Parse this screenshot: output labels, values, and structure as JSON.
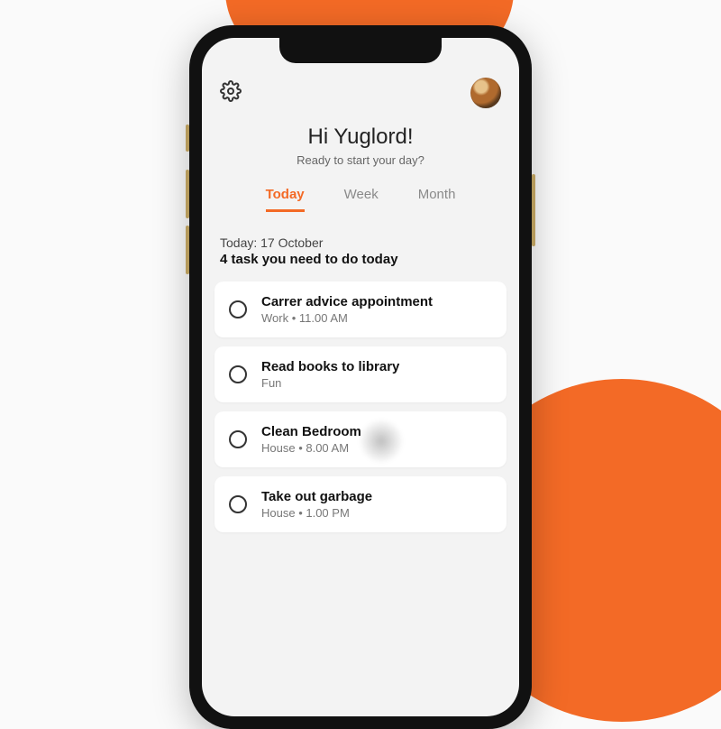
{
  "colors": {
    "accent": "#f36a26"
  },
  "greeting": {
    "title": "Hi Yuglord!",
    "subtitle": "Ready to start your day?"
  },
  "tabs": {
    "today": "Today",
    "week": "Week",
    "month": "Month",
    "active": "today"
  },
  "date": {
    "label": "Today: 17 October",
    "summary": "4 task you need to do today"
  },
  "tasks": [
    {
      "title": "Carrer advice appointment",
      "meta": "Work  •  11.00 AM"
    },
    {
      "title": "Read books to library",
      "meta": "Fun"
    },
    {
      "title": "Clean Bedroom",
      "meta": "House  •  8.00 AM"
    },
    {
      "title": "Take out garbage",
      "meta": "House  •  1.00 PM"
    }
  ]
}
